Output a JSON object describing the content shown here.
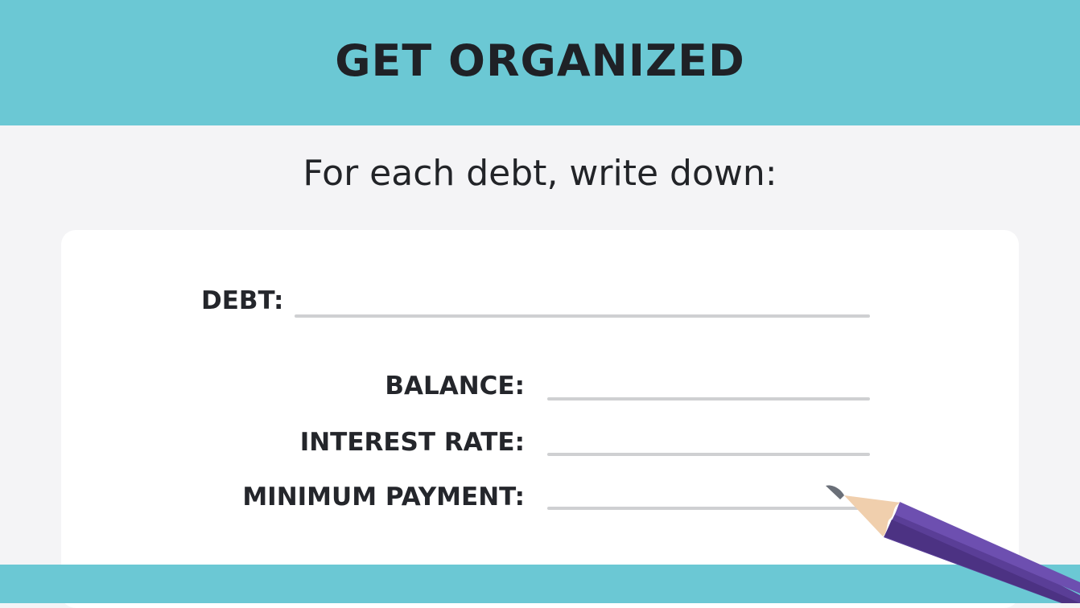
{
  "header": {
    "title": "GET ORGANIZED"
  },
  "subtitle": "For each debt, write down:",
  "form": {
    "debt_label": "DEBT:",
    "balance_label": "BALANCE:",
    "interest_rate_label": "INTEREST RATE:",
    "minimum_payment_label": "MINIMUM PAYMENT:"
  },
  "colors": {
    "banner": "#6bc8d4",
    "background": "#f4f4f6",
    "card": "#ffffff",
    "text": "#1f2126",
    "line": "#cfd0d2",
    "pencil_body": "#5a3e97",
    "pencil_wood": "#f0cfad",
    "pencil_tip": "#6a6f78"
  },
  "icons": {
    "pencil": "pencil-icon"
  }
}
